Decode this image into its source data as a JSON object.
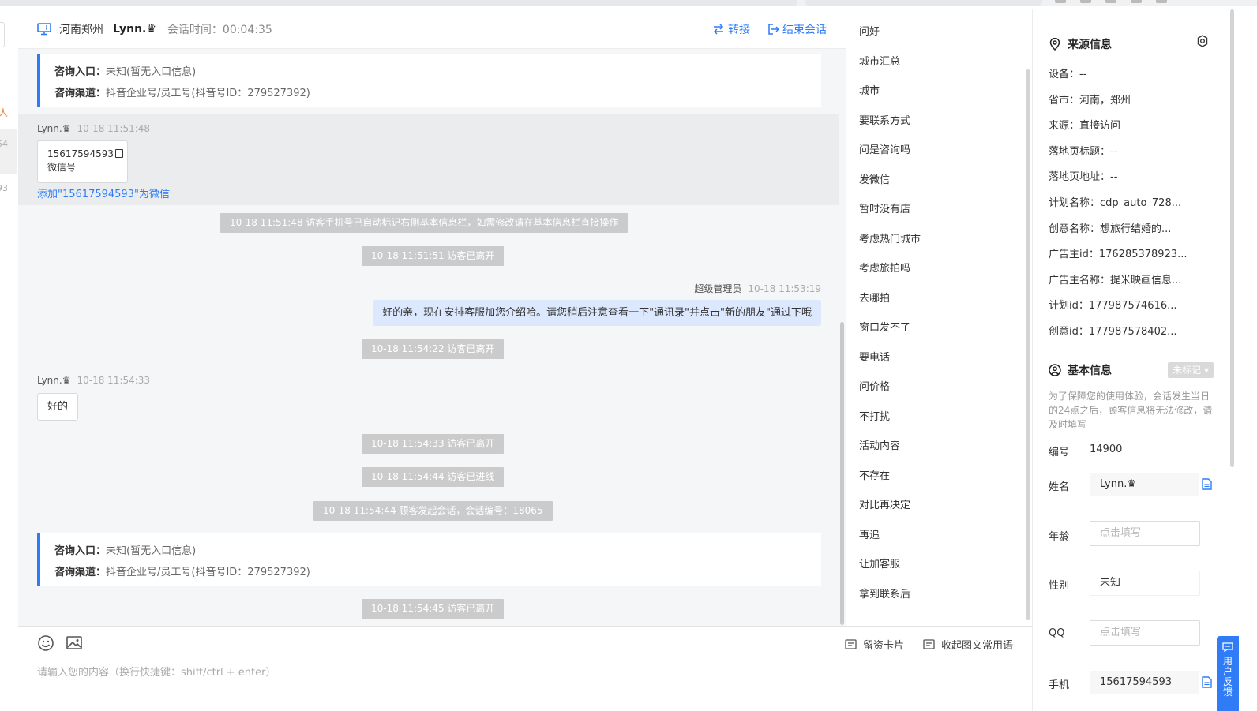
{
  "header": {
    "location": "河南郑州",
    "visitor_name": "Lynn.♛",
    "session_time_label": "会话时间：00:04:35",
    "transfer_label": "转接",
    "end_label": "结束会话"
  },
  "left_sidebar": {
    "partial_text_1": "人",
    "partial_text_2": "54",
    "partial_text_3": "93"
  },
  "messages": {
    "entry_card_1": {
      "entry_label": "咨询入口：",
      "entry_value": "未知(暂无入口信息)",
      "channel_label": "咨询渠道：",
      "channel_value": "抖音企业号/员工号(抖音号ID：279527392)"
    },
    "msg1_sender": "Lynn.♛",
    "msg1_time": "10-18 11:51:48",
    "wechat_card": {
      "number": "15617594593",
      "type_label": "微信号"
    },
    "add_wechat_link": "添加\"15617594593\"为微信",
    "sys1": "10-18 11:51:48 访客手机号已自动标记右侧基本信息栏，如需修改请在基本信息栏直接操作",
    "sys2": "10-18 11:51:51 访客已离开",
    "agent_name": "超级管理员",
    "agent_time": "10-18 11:53:19",
    "agent_message": "好的亲，现在安排客服加您介绍哈。请您稍后注意查看一下\"通讯录\"并点击\"新的朋友\"通过下哦",
    "sys3": "10-18 11:54:22 访客已离开",
    "msg2_sender": "Lynn.♛",
    "msg2_time": "10-18 11:54:33",
    "msg2_text": "好的",
    "sys4": "10-18 11:54:33 访客已离开",
    "sys5": "10-18 11:54:44 访客已进线",
    "sys6": "10-18 11:54:44 顾客发起会话，会话编号：18065",
    "entry_card_2": {
      "entry_label": "咨询入口：",
      "entry_value": "未知(暂无入口信息)",
      "channel_label": "咨询渠道：",
      "channel_value": "抖音企业号/员工号(抖音号ID：279527392)"
    },
    "sys7": "10-18 11:54:45 访客已离开"
  },
  "input": {
    "placeholder": "请输入您的内容（换行快捷键：shift/ctrl + enter）",
    "card_button": "留资卡片",
    "collapse_button": "收起图文常用语"
  },
  "quick_phrases": [
    "问好",
    "城市汇总",
    "城市",
    "要联系方式",
    "问是咨询吗",
    "发微信",
    "暂时没有店",
    "考虑热门城市",
    "考虑旅拍吗",
    "去哪拍",
    "窗口发不了",
    "要电话",
    "问价格",
    "不打扰",
    "活动内容",
    "不存在",
    "对比再决定",
    "再追",
    "让加客服",
    "拿到联系后"
  ],
  "source_info": {
    "title": "来源信息",
    "items": [
      "设备：--",
      "省市：河南，郑州",
      "来源：直接访问",
      "落地页标题：--",
      "落地页地址：--",
      "计划名称：cdp_auto_728...",
      "创意名称：想旅行结婚的...",
      "广告主id：176285378923...",
      "广告主名称：提米映画信息...",
      "计划id：177987574616...",
      "创意id：177987578402..."
    ]
  },
  "basic_info": {
    "title": "基本信息",
    "tag": "未标记",
    "note": "为了保障您的使用体验，会话发生当日的24点之后，顾客信息将无法修改，请及时填写",
    "id_label": "编号",
    "id_value": "14900",
    "name_label": "姓名",
    "name_value": "Lynn.♛",
    "age_label": "年龄",
    "age_placeholder": "点击填写",
    "gender_label": "性别",
    "gender_value": "未知",
    "qq_label": "QQ",
    "qq_placeholder": "点击填写",
    "phone_label": "手机",
    "phone_value": "15617594593"
  },
  "feedback": {
    "label": "用户反馈"
  },
  "colors": {
    "accent": "#2f7cf6",
    "system_bubble": "#cbcbcb",
    "agent_bubble": "#dbe8fd"
  }
}
